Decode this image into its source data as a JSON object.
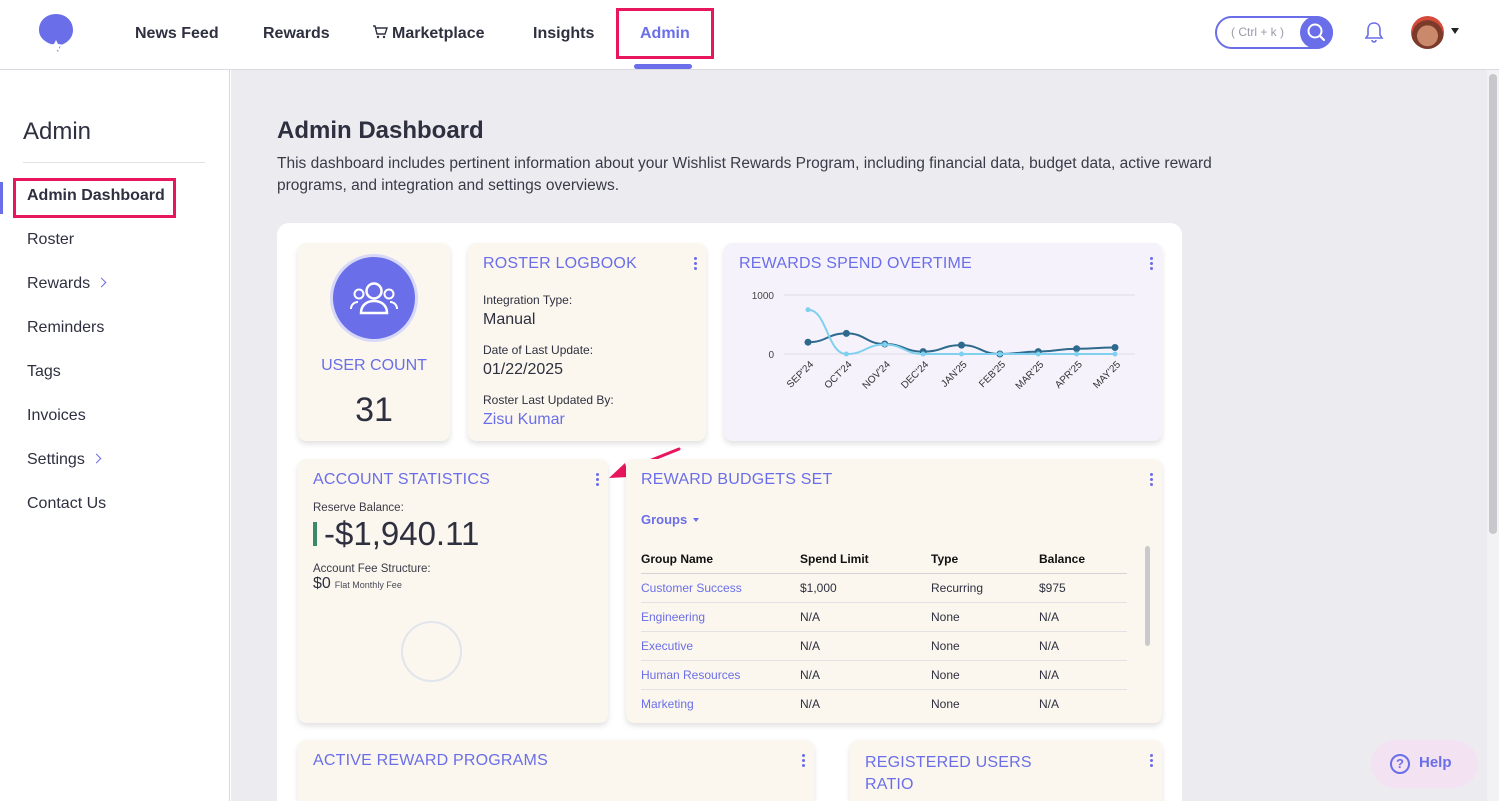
{
  "nav": {
    "items": [
      {
        "label": "News Feed"
      },
      {
        "label": "Rewards"
      },
      {
        "label": "Marketplace"
      },
      {
        "label": "Insights"
      },
      {
        "label": "Admin"
      }
    ],
    "active": "Admin",
    "search_placeholder": "( Ctrl + k )"
  },
  "sidebar": {
    "title": "Admin",
    "items": [
      {
        "label": "Admin Dashboard"
      },
      {
        "label": "Roster"
      },
      {
        "label": "Rewards"
      },
      {
        "label": "Reminders"
      },
      {
        "label": "Tags"
      },
      {
        "label": "Invoices"
      },
      {
        "label": "Settings"
      },
      {
        "label": "Contact Us"
      }
    ]
  },
  "page": {
    "title": "Admin Dashboard",
    "description": "This dashboard includes pertinent information about your Wishlist Rewards Program, including financial data, budget data, active reward programs, and integration and settings overviews."
  },
  "user_count": {
    "label": "USER COUNT",
    "value": "31"
  },
  "roster_logbook": {
    "title": "ROSTER LOGBOOK",
    "integration_label": "Integration Type:",
    "integration_value": "Manual",
    "date_label": "Date of Last Update:",
    "date_value": "01/22/2025",
    "updated_by_label": "Roster Last Updated By:",
    "updated_by_value": "Zisu Kumar"
  },
  "rewards_spend": {
    "title": "REWARDS SPEND OVERTIME"
  },
  "chart_data": {
    "type": "line",
    "title": "REWARDS SPEND OVERTIME",
    "categories": [
      "SEP'24",
      "OCT'24",
      "NOV'24",
      "DEC'24",
      "JAN'25",
      "FEB'25",
      "MAR'25",
      "APR'25",
      "MAY'25"
    ],
    "y_ticks": [
      "1000",
      "0"
    ],
    "ylim": [
      0,
      1000
    ],
    "series": [
      {
        "values": [
          200,
          350,
          170,
          40,
          150,
          0,
          40,
          90,
          110
        ],
        "color": "#2e6a8e"
      },
      {
        "values": [
          750,
          0,
          160,
          0,
          0,
          0,
          0,
          0,
          0
        ],
        "color": "#7ed0ee"
      }
    ],
    "grid": true
  },
  "account_statistics": {
    "title": "ACCOUNT STATISTICS",
    "reserve_label": "Reserve Balance:",
    "reserve_value": "-$1,940.11",
    "fee_label": "Account Fee Structure:",
    "fee_value": "$0",
    "fee_note": "Flat Monthly Fee"
  },
  "reward_budgets": {
    "title": "REWARD BUDGETS SET",
    "filter": "Groups",
    "columns": [
      "Group Name",
      "Spend Limit",
      "Type",
      "Balance"
    ],
    "rows": [
      [
        "Customer Success",
        "$1,000",
        "Recurring",
        "$975"
      ],
      [
        "Engineering",
        "N/A",
        "None",
        "N/A"
      ],
      [
        "Executive",
        "N/A",
        "None",
        "N/A"
      ],
      [
        "Human Resources",
        "N/A",
        "None",
        "N/A"
      ],
      [
        "Marketing",
        "N/A",
        "None",
        "N/A"
      ]
    ]
  },
  "active_programs": {
    "title": "ACTIVE REWARD PROGRAMS"
  },
  "registered_ratio": {
    "title": "REGISTERED USERS RATIO"
  },
  "help": {
    "label": "Help"
  },
  "colors": {
    "accent": "#6a6ee8",
    "highlight_box": "#e8175d",
    "card_bg": "#fbf7ee"
  }
}
